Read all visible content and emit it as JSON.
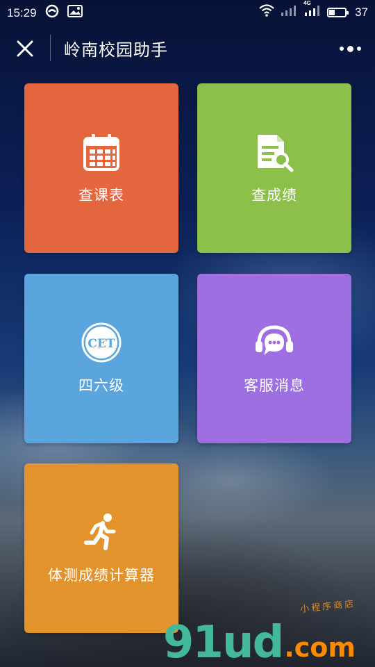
{
  "status": {
    "time": "15:29",
    "battery": "37",
    "network": "4G"
  },
  "nav": {
    "title": "岭南校园助手"
  },
  "tiles": [
    {
      "label": "查课表",
      "icon": "calendar-icon",
      "color": "#e4663f"
    },
    {
      "label": "查成绩",
      "icon": "document-search-icon",
      "color": "#8cc04a"
    },
    {
      "label": "四六级",
      "icon": "cet-badge-icon",
      "icon_text": "CET",
      "color": "#5aa5de"
    },
    {
      "label": "客服消息",
      "icon": "headset-chat-icon",
      "color": "#9e6fe0"
    },
    {
      "label": "体测成绩计算器",
      "icon": "running-person-icon",
      "color": "#e3932c"
    }
  ],
  "watermark": {
    "main": "91ud",
    "suffix": ".com",
    "sub": "小程序商店"
  }
}
